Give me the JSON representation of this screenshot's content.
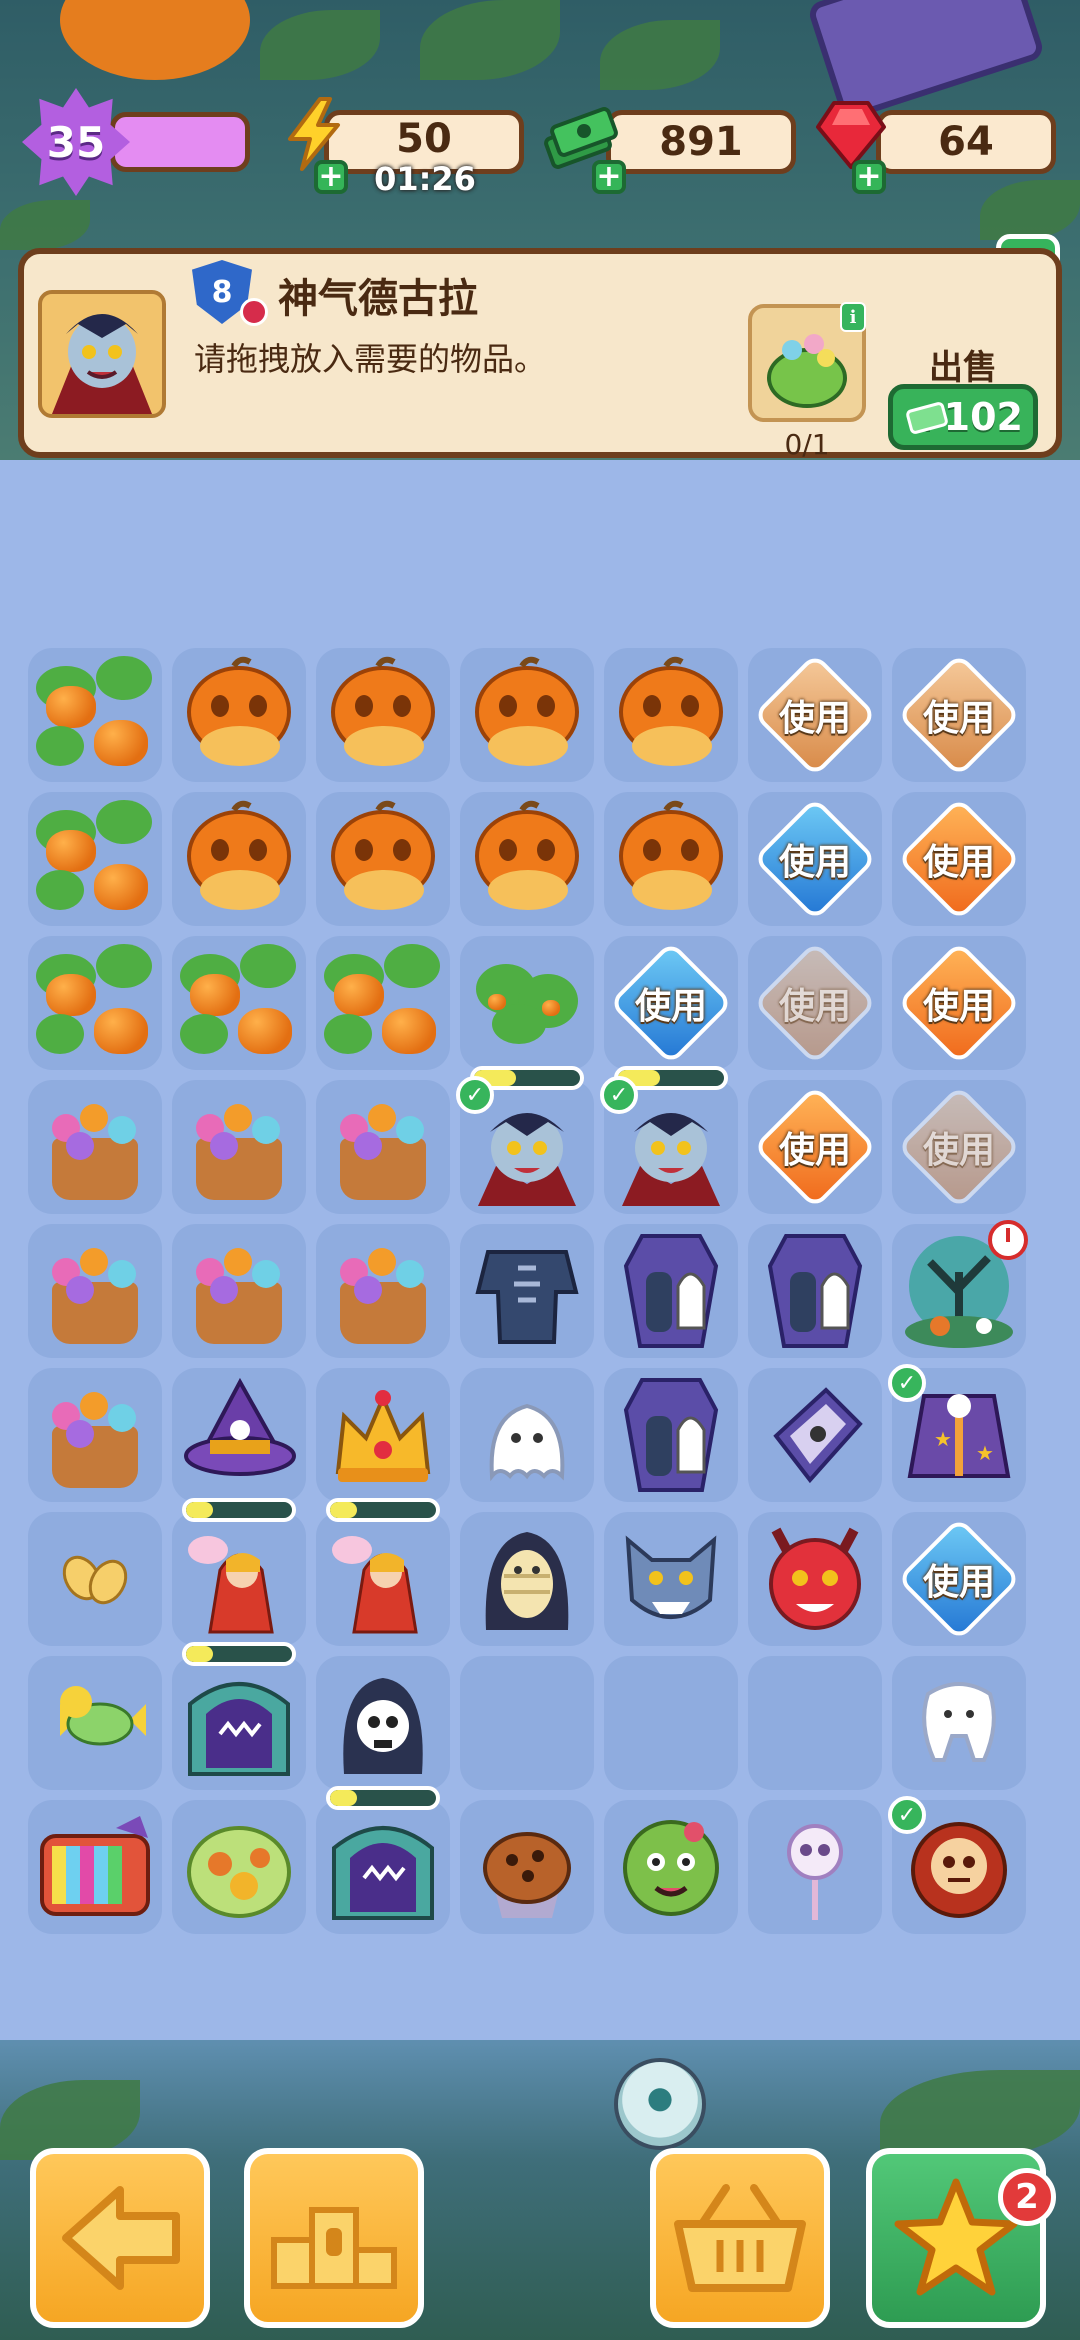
{
  "hud": {
    "level": "35",
    "energy": "50",
    "energy_timer": "01:26",
    "cash": "891",
    "gems": "64"
  },
  "request": {
    "level": "8",
    "name": "神气德古拉",
    "instruction": "请拖拽放入需要的物品。",
    "progress": "0/1",
    "sell_label": "出售",
    "sell_reward": "+102",
    "info_label": "i"
  },
  "board": {
    "use_label": "使用"
  },
  "bottom_nav": {
    "notification_count": "2"
  },
  "colors": {
    "background": "#9db7e8",
    "panel": "#f7e7cb",
    "panel_border": "#6e3e1d",
    "green_button": "#38b35a",
    "level_bar": "#e48cf2",
    "cell": "#8facdf"
  }
}
